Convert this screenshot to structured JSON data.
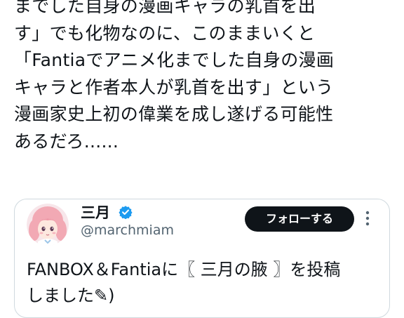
{
  "post": {
    "text_lines": [
      "までした自身の漫画キャラの乳首を出",
      "す」でも化物なのに、このままいくと",
      "「Fantiaでアニメ化までした自身の漫画",
      "キャラと作者本人が乳首を出す」という",
      "漫画家史上初の偉業を成し遂げる可能性",
      "あるだろ......"
    ]
  },
  "quote": {
    "author_name": "三月",
    "verified": true,
    "author_handle": "@marchmiam",
    "follow_label": "フォローする",
    "more_icon": "more-vertical-icon",
    "text_lines": [
      "FANBOX＆Fantiaに〖 三月の腋 〗を投稿",
      "しました✎)"
    ]
  },
  "colors": {
    "text": "#0f1419",
    "secondary_text": "#536471",
    "border": "#cfd9de",
    "verified_blue": "#1d9bf0",
    "follow_button_bg": "#0f1419",
    "follow_button_text": "#ffffff"
  }
}
